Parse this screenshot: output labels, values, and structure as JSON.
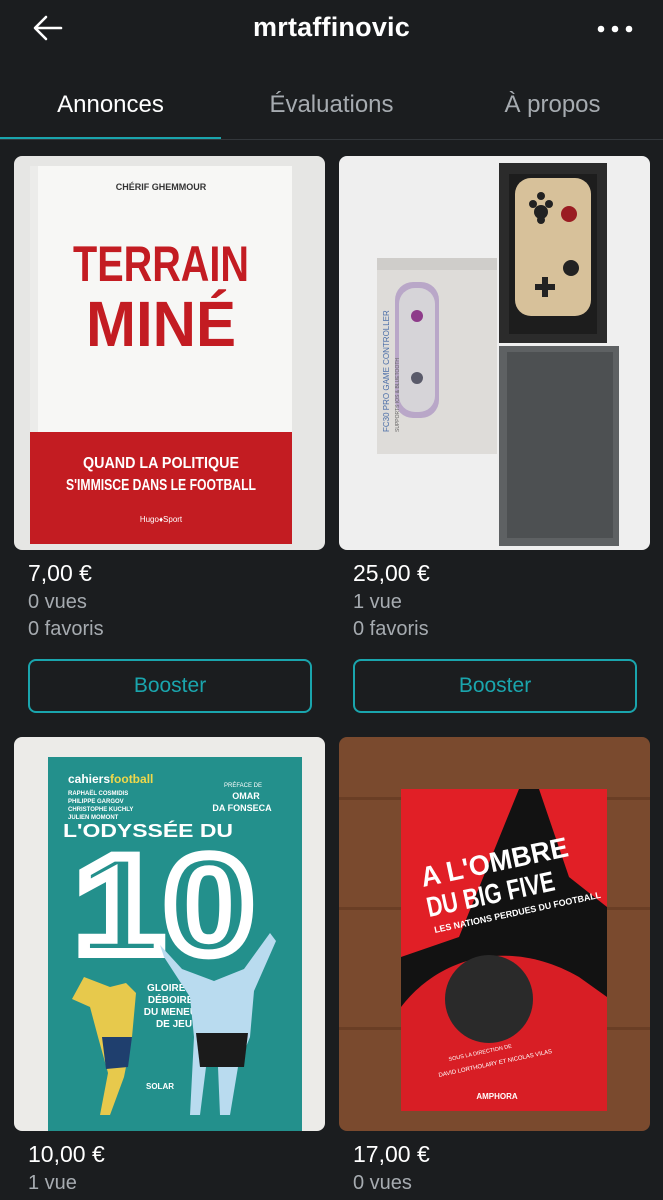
{
  "header": {
    "username": "mrtaffinovic",
    "back_icon": "arrow-left-icon",
    "more_icon": "more-horizontal-icon"
  },
  "tabs": [
    {
      "label": "Annonces",
      "active": true
    },
    {
      "label": "Évaluations",
      "active": false
    },
    {
      "label": "À propos",
      "active": false
    }
  ],
  "colors": {
    "accent": "#1aa5ad",
    "background": "#1b1d1f",
    "muted": "#a6abb0"
  },
  "listings": [
    {
      "price": "7,00 €",
      "views": "0 vues",
      "favorites": "0 favoris",
      "booster_label": "Booster",
      "cover": {
        "author": "CHÉRIF GHEMMOUR",
        "title_line1": "TERRAIN",
        "title_line2": "MINÉ",
        "subtitle_line1": "QUAND LA POLITIQUE",
        "subtitle_line2": "S'IMMISCE DANS LE FOOTBALL",
        "publisher": "Hugo♦Sport"
      }
    },
    {
      "price": "25,00 €",
      "views": "1 vue",
      "favorites": "0 favoris",
      "booster_label": "Booster",
      "cover": {
        "box_text": "FC30 PRO GAME CONTROLLER",
        "box_subtext": "SUPPORTS IOS & BLUETOOTH"
      }
    },
    {
      "price": "10,00 €",
      "views": "1 vue",
      "cover": {
        "brand_prefix": "cahiers",
        "brand_suffix": "football",
        "authors": [
          "RAPHAËL COSMIDIS",
          "PHILIPPE GARGOV",
          "CHRISTOPHE KUCHLY",
          "JULIEN MOMONT"
        ],
        "preface_label": "PRÉFACE DE",
        "preface_name_line1": "OMAR",
        "preface_name_line2": "DA FONSECA",
        "title": "L'ODYSSÉE DU",
        "big_number": "10",
        "subtitle_lines": [
          "GLOIRE ET",
          "DÉBOIRES",
          "DU MENEUR",
          "DE JEU"
        ],
        "publisher": "SOLAR"
      }
    },
    {
      "price": "17,00 €",
      "views": "0 vues",
      "cover": {
        "title_line1": "A L'OMBRE",
        "title_line2": "DU BIG FIVE",
        "subtitle": "LES NATIONS PERDUES DU FOOTBALL",
        "direction_line1": "SOUS LA DIRECTION DE",
        "direction_line2": "DAVID LORTHOLARY ET NICOLAS VILAS",
        "publisher": "AMPHORA"
      }
    }
  ]
}
